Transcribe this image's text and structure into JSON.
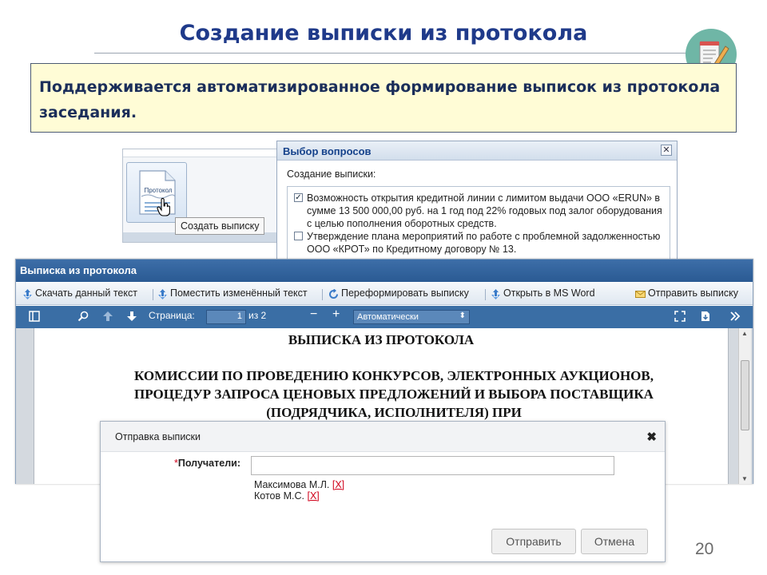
{
  "slide": {
    "title": "Создание выписки из протокола",
    "info": "Поддерживается автоматизированное формирование выписок из протокола заседания.",
    "page_number": "20"
  },
  "protocol_panel": {
    "button_label": "Протокол",
    "tooltip": "Создать выписку"
  },
  "questions_dialog": {
    "title": "Выбор вопросов",
    "subtitle": "Создание выписки:",
    "items": [
      {
        "checked": true,
        "text": "Возможность открытия кредитной линии с лимитом выдачи ООО «ERUN» в сумме 13 500 000,00 руб. на 1 год под 22% годовых под залог оборудования с целью пополнения оборотных средств."
      },
      {
        "checked": false,
        "text": "Утверждение плана мероприятий по работе с проблемной задолженностью ООО «КРОТ» по Кредитному договору № 13."
      }
    ]
  },
  "main_window": {
    "title": "Выписка из протокола",
    "toolbar": {
      "download": "Скачать данный текст",
      "place": "Поместить изменённый текст",
      "reformat": "Переформировать выписку",
      "open_word": "Открыть в MS Word",
      "send": "Отправить выписку"
    },
    "viewer": {
      "page_label": "Страница:",
      "page_value": "1",
      "page_of": "из 2",
      "zoom": "Автоматически"
    },
    "document": {
      "heading": "ВЫПИСКА ИЗ ПРОТОКОЛА",
      "subheading": "КОМИССИИ ПО ПРОВЕДЕНИЮ КОНКУРСОВ, ЭЛЕКТРОННЫХ АУКЦИОНОВ, ПРОЦЕДУР ЗАПРОСА ЦЕНОВЫХ ПРЕДЛОЖЕНИЙ И ВЫБОРА ПОСТАВЩИКА (ПОДРЯДЧИКА, ИСПОЛНИТЕЛЯ) ПРИ"
    }
  },
  "send_dialog": {
    "title": "Отправка выписки",
    "recipients_label": "Получатели:",
    "recipients_value": "",
    "recipients": [
      {
        "name": "Максимова М.Л.",
        "remove": "[X]"
      },
      {
        "name": "Котов М.С.",
        "remove": "[X]"
      }
    ],
    "send_button": "Отправить",
    "cancel_button": "Отмена"
  }
}
